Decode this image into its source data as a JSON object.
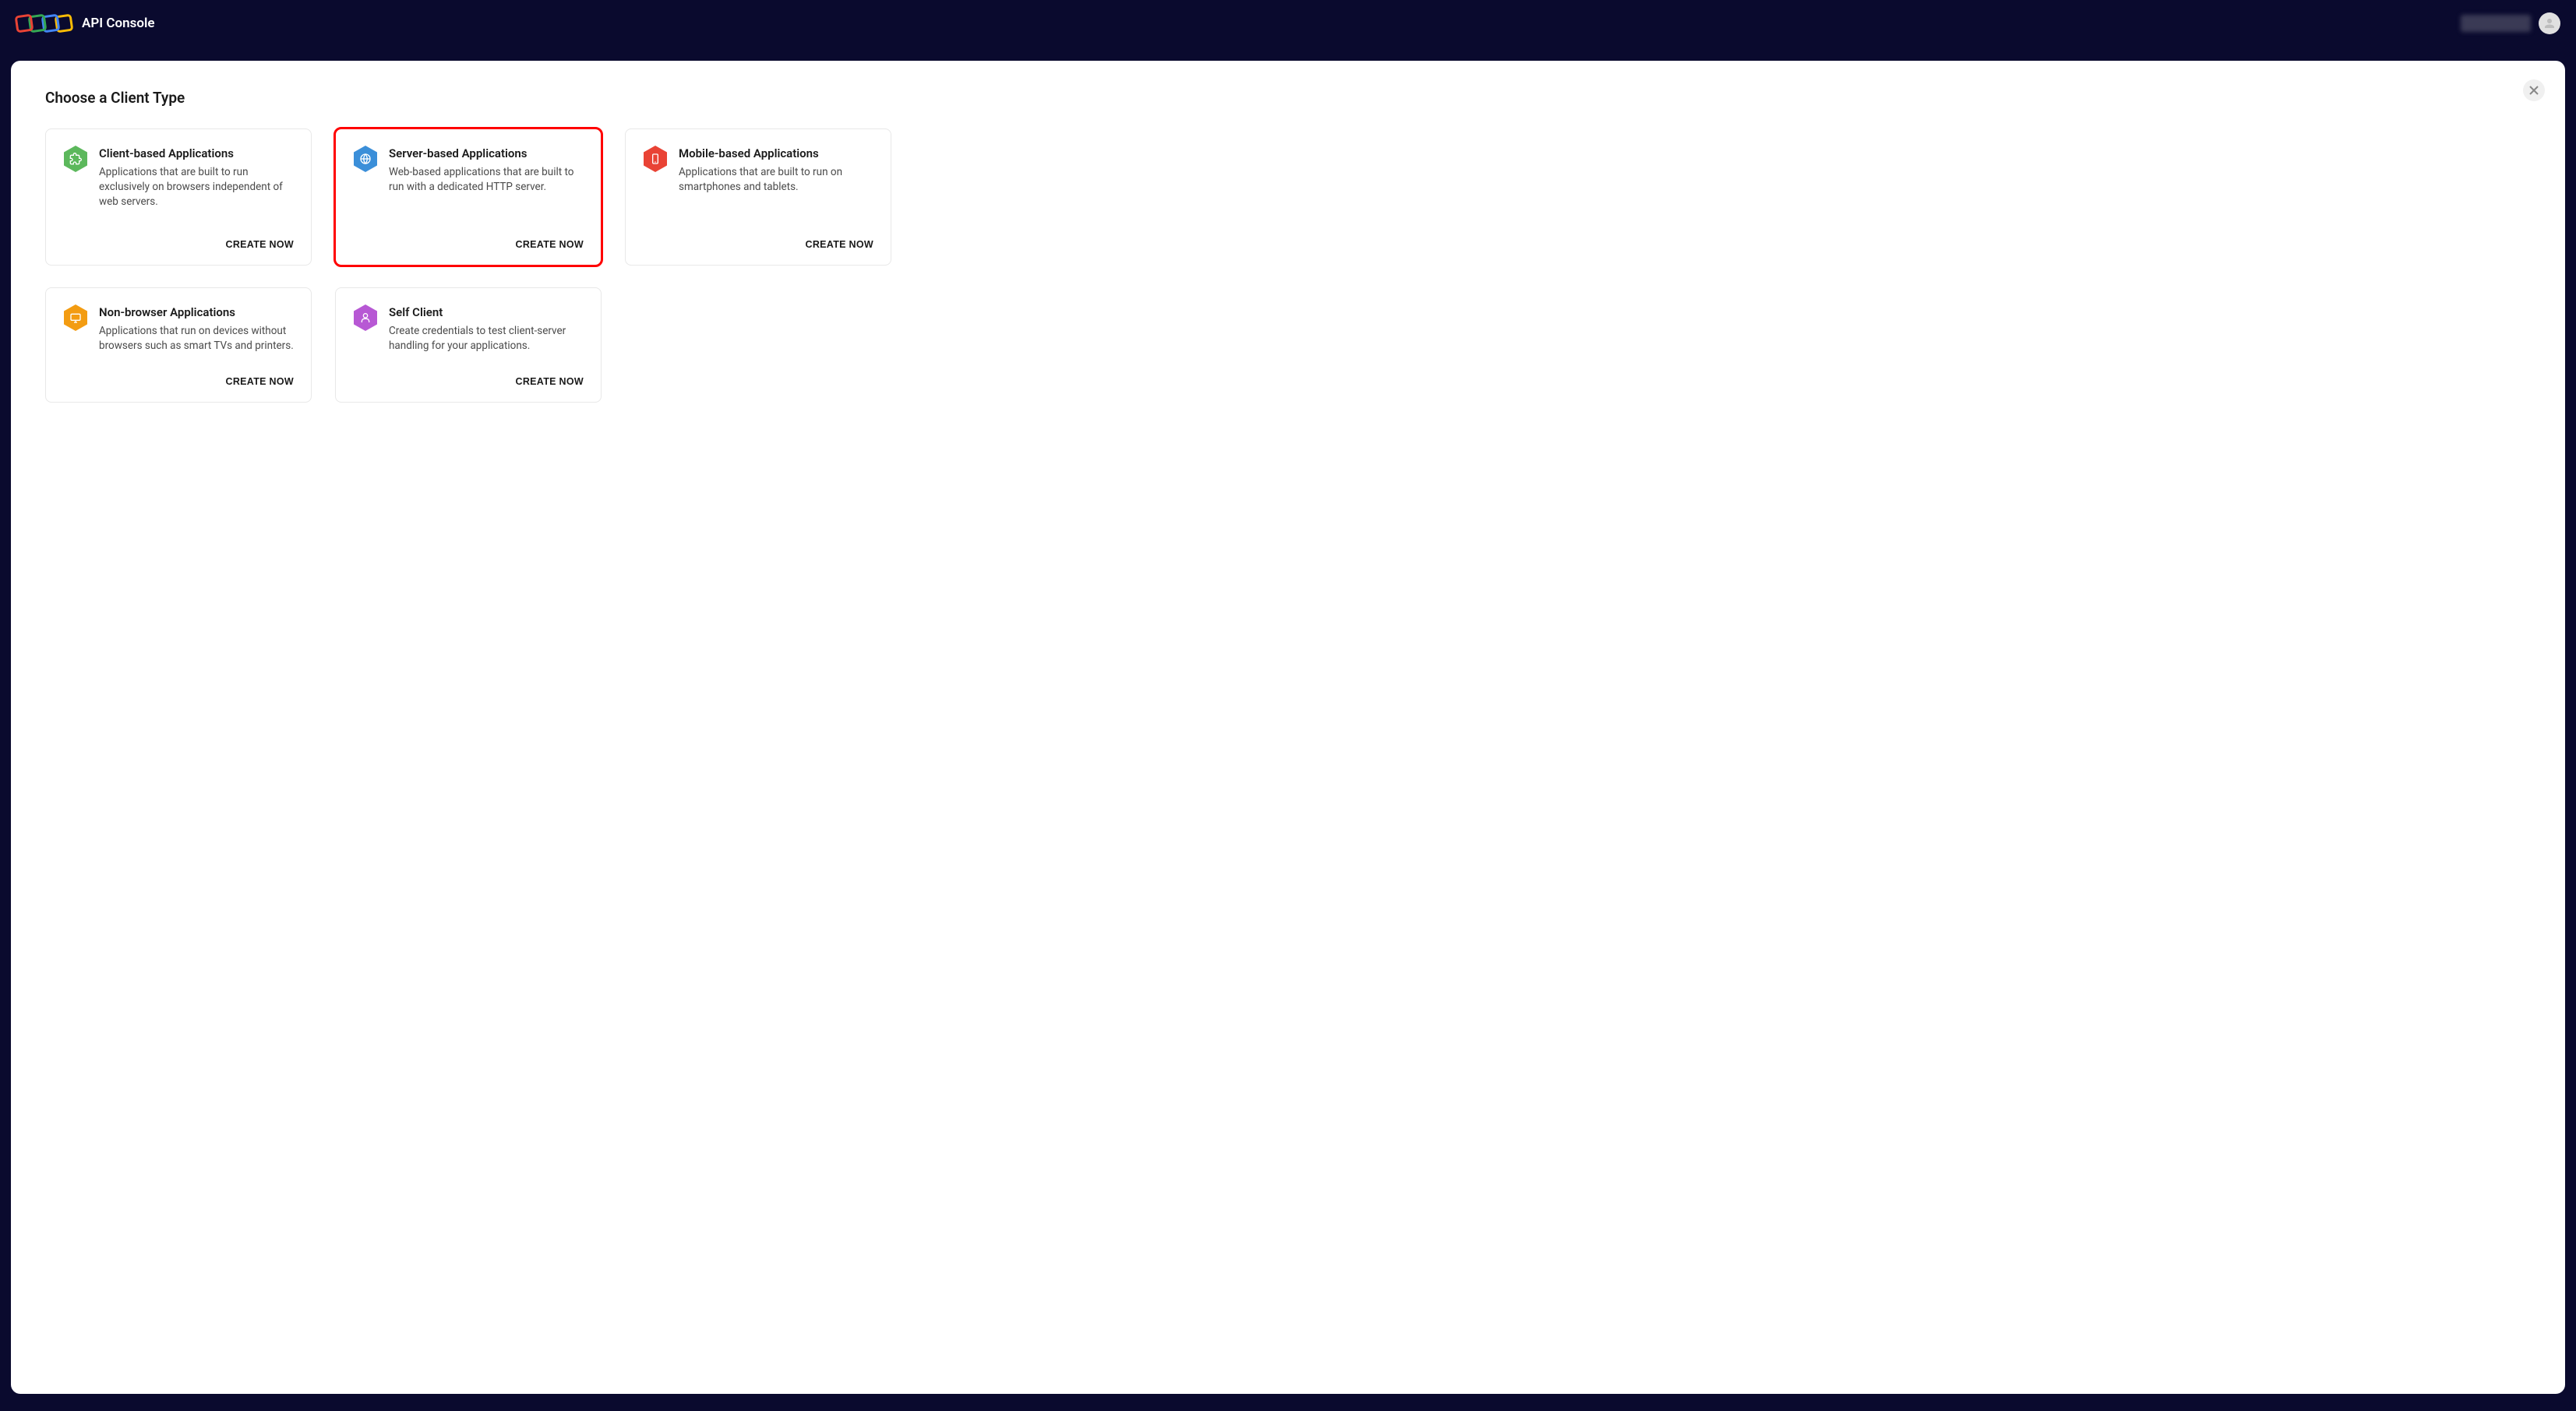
{
  "header": {
    "app_title": "API Console"
  },
  "page": {
    "title": "Choose a Client Type"
  },
  "cards": [
    {
      "title": "Client-based Applications",
      "description": "Applications that are built to run exclusively on browsers independent of web servers.",
      "action": "CREATE NOW",
      "icon": "puzzle",
      "color": "#5cb85c",
      "highlighted": false
    },
    {
      "title": "Server-based Applications",
      "description": "Web-based applications that are built to run with a dedicated HTTP server.",
      "action": "CREATE NOW",
      "icon": "globe",
      "color": "#3b8fd9",
      "highlighted": true
    },
    {
      "title": "Mobile-based Applications",
      "description": "Applications that are built to run on smartphones and tablets.",
      "action": "CREATE NOW",
      "icon": "mobile",
      "color": "#e94335",
      "highlighted": false
    },
    {
      "title": "Non-browser Applications",
      "description": "Applications that run on devices without browsers such as smart TVs and printers.",
      "action": "CREATE NOW",
      "icon": "monitor",
      "color": "#f39c12",
      "highlighted": false
    },
    {
      "title": "Self Client",
      "description": "Create credentials to test client-server handling for your applications.",
      "action": "CREATE NOW",
      "icon": "person",
      "color": "#b758d4",
      "highlighted": false
    }
  ]
}
